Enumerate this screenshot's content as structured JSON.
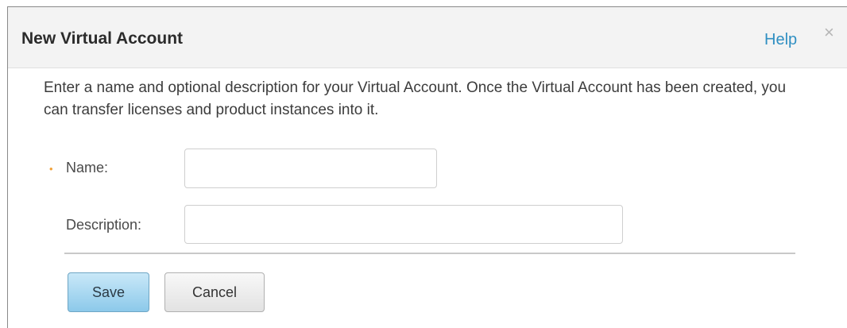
{
  "dialog": {
    "title": "New Virtual Account",
    "help_label": "Help",
    "close_symbol": "×",
    "close_icon": "close-icon"
  },
  "intro": {
    "text": "Enter a name and optional description for your Virtual Account. Once the Virtual Account has been created, you can transfer licenses and product instances into it."
  },
  "form": {
    "required_marker": "•",
    "name_label": "Name:",
    "name_value": "",
    "description_label": "Description:",
    "description_value": ""
  },
  "buttons": {
    "save_label": "Save",
    "cancel_label": "Cancel"
  },
  "colors": {
    "help_link": "#2f8fc2",
    "required_marker": "#f2a23a",
    "save_button": "#8cc9ea",
    "header_background": "#f3f3f3"
  }
}
